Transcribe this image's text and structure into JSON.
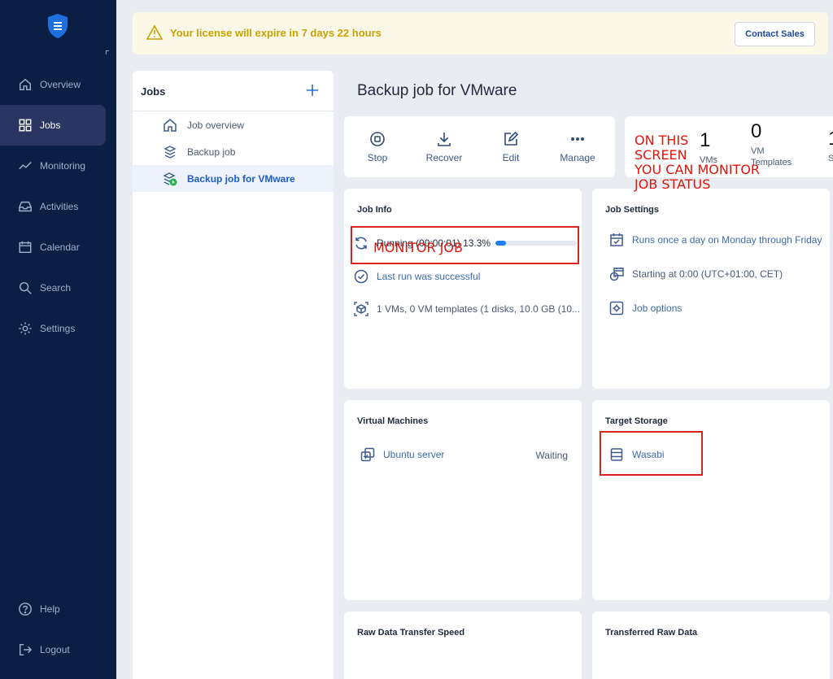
{
  "sidebar": {
    "items": [
      {
        "label": "Overview",
        "icon": "home-icon"
      },
      {
        "label": "Jobs",
        "icon": "grid-icon"
      },
      {
        "label": "Monitoring",
        "icon": "trend-icon"
      },
      {
        "label": "Activities",
        "icon": "inbox-icon"
      },
      {
        "label": "Calendar",
        "icon": "calendar-icon"
      },
      {
        "label": "Search",
        "icon": "search-icon"
      },
      {
        "label": "Settings",
        "icon": "gear-icon"
      }
    ],
    "bottom": [
      {
        "label": "Help",
        "icon": "help-icon"
      },
      {
        "label": "Logout",
        "icon": "logout-icon"
      }
    ]
  },
  "banner": {
    "message": "Your license will expire in 7 days 22 hours",
    "contact_label": "Contact Sales"
  },
  "jobs_panel": {
    "title": "Jobs",
    "items": [
      {
        "label": "Job overview"
      },
      {
        "label": "Backup job"
      },
      {
        "label": "Backup job for VMware"
      }
    ]
  },
  "main": {
    "title": "Backup job for VMware",
    "toolbar": {
      "stop": "Stop",
      "recover": "Recover",
      "edit": "Edit",
      "manage": "Manage"
    },
    "stats": {
      "vms_count": "1",
      "vms_label": "VMs",
      "templates_count": "0",
      "templates_label_1": "VM",
      "templates_label_2": "Templates",
      "third_count": "1",
      "third_label": "S"
    },
    "job_info": {
      "title": "Job Info",
      "running_text": "Running (00:00:01) 13.3%",
      "progress": 0.133,
      "last_run": "Last run was successful",
      "summary": "1 VMs, 0 VM templates (1 disks, 10.0 GB (10..."
    },
    "job_settings": {
      "title": "Job Settings",
      "schedule": "Runs once a day on Monday through Friday",
      "start": "Starting at 0:00 (UTC+01:00, CET)",
      "options": "Job options"
    },
    "virtual_machines": {
      "title": "Virtual Machines",
      "vm_name": "Ubuntu server",
      "vm_status": "Waiting"
    },
    "target_storage": {
      "title": "Target Storage",
      "name": "Wasabi"
    },
    "raw_speed_title": "Raw Data Transfer Speed",
    "transferred_title": "Transferred Raw Data"
  },
  "annotations": {
    "screen_note_1": "ON THIS",
    "screen_note_2": "SCREEN",
    "screen_note_3": "YOU CAN MONITOR",
    "screen_note_4": "JOB STATUS",
    "monitor_job": "MONITOR JOB"
  },
  "colors": {
    "sidebar_bg": "#0b1e44",
    "accent": "#1e5cc8",
    "warning": "#c9a100",
    "annotation": "#e0150c"
  }
}
